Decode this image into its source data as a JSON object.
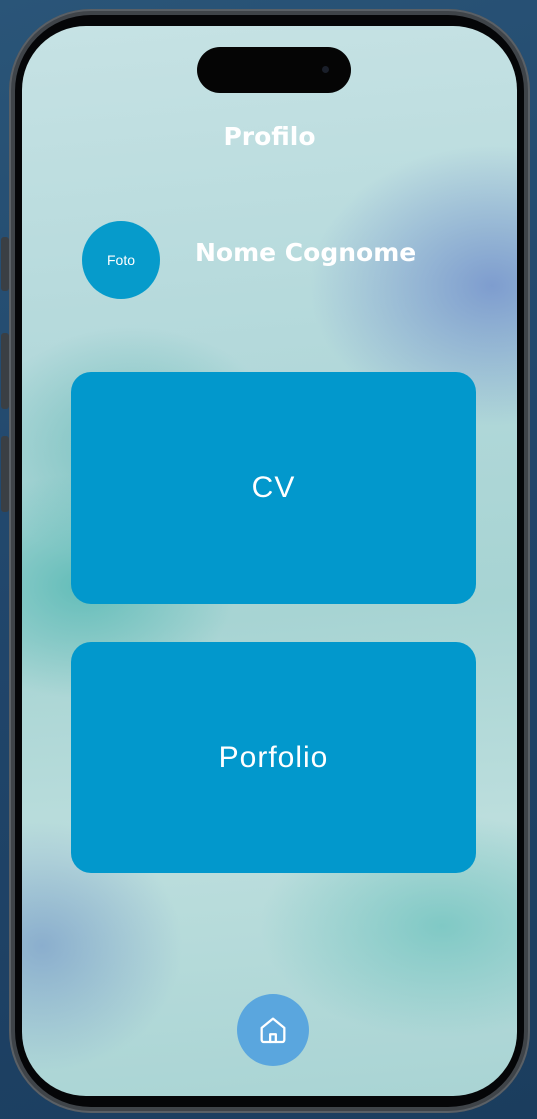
{
  "header": {
    "title": "Profilo"
  },
  "profile": {
    "avatar_label": "Foto",
    "name": "Nome Cognome"
  },
  "cards": [
    {
      "label": "CV"
    },
    {
      "label": "Porfolio"
    }
  ],
  "nav": {
    "home_icon": "home-icon"
  },
  "colors": {
    "accent": "#0298cc",
    "avatar": "#069bcb",
    "home_button": "#5aa6de",
    "text": "#ffffff"
  }
}
